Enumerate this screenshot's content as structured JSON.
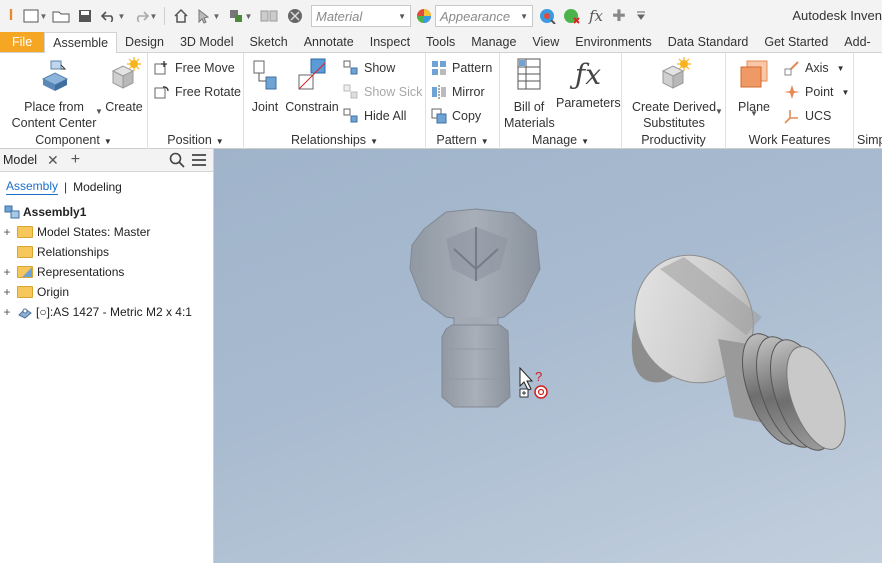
{
  "qat": {
    "material_placeholder": "Material",
    "appearance_placeholder": "Appearance",
    "fx": "fx",
    "app_title": "Autodesk Inven"
  },
  "tabs": [
    "File",
    "Assemble",
    "Design",
    "3D Model",
    "Sketch",
    "Annotate",
    "Inspect",
    "Tools",
    "Manage",
    "View",
    "Environments",
    "Data Standard",
    "Get Started",
    "Add-"
  ],
  "active_tab": "Assemble",
  "ribbon": {
    "component": {
      "title": "Component",
      "place_line1": "Place from",
      "place_line2": "Content Center",
      "create": "Create"
    },
    "position": {
      "title": "Position",
      "free_move": "Free Move",
      "free_rotate": "Free Rotate"
    },
    "relationships": {
      "title": "Relationships",
      "joint": "Joint",
      "constrain": "Constrain",
      "show": "Show",
      "show_sick": "Show Sick",
      "hide_all": "Hide All"
    },
    "pattern": {
      "title": "Pattern",
      "pattern": "Pattern",
      "mirror": "Mirror",
      "copy": "Copy"
    },
    "manage": {
      "title": "Manage",
      "bom_line1": "Bill of",
      "bom_line2": "Materials",
      "parameters": "Parameters"
    },
    "productivity": {
      "title": "Productivity",
      "derived_line1": "Create Derived",
      "derived_line2": "Substitutes"
    },
    "work_features": {
      "title": "Work Features",
      "plane": "Plane",
      "axis": "Axis",
      "point": "Point",
      "ucs": "UCS"
    },
    "simp": {
      "title": "Simp"
    }
  },
  "browser": {
    "title": "Model",
    "modes": [
      "Assembly",
      "Modeling"
    ],
    "active_mode": "Assembly",
    "tree": [
      {
        "label": "Assembly1",
        "expander": "",
        "kind": "assembly",
        "bold": true
      },
      {
        "label": "Model States: Master",
        "expander": "+",
        "kind": "folder"
      },
      {
        "label": "Relationships",
        "expander": "",
        "kind": "folder"
      },
      {
        "label": "Representations",
        "expander": "+",
        "kind": "folder"
      },
      {
        "label": "Origin",
        "expander": "+",
        "kind": "folder"
      },
      {
        "label": "[○]:AS 1427 - Metric M2 x 4:1",
        "expander": "+",
        "kind": "part"
      }
    ]
  },
  "viewport": {
    "cursor_hint": "?"
  }
}
